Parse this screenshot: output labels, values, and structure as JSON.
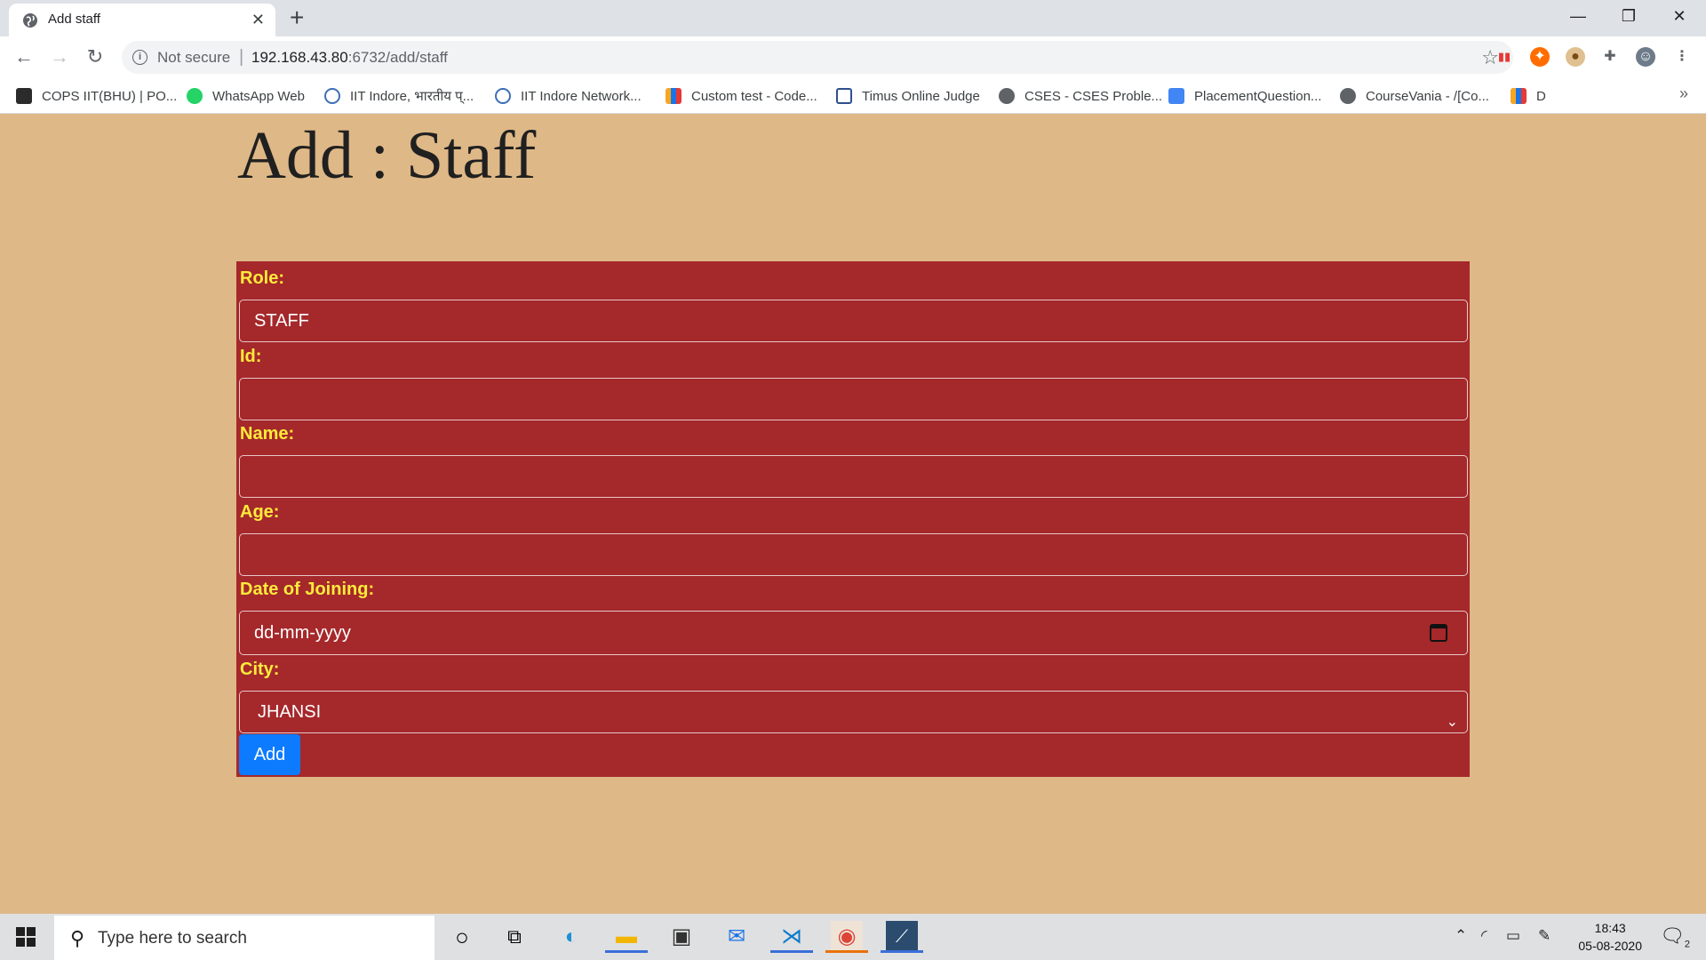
{
  "browser": {
    "tab_title": "Add staff",
    "tab_close": "✕",
    "new_tab": "+",
    "window_controls": {
      "minimize": "—",
      "restore": "❐",
      "close": "✕"
    },
    "security_label": "Not secure",
    "url_host": "192.168.43.80",
    "url_path": ":6732/add/staff",
    "bookmarks": [
      {
        "label": "COPS IIT(BHU) | PO...",
        "icon_color": "#2b2b2b"
      },
      {
        "label": "WhatsApp Web",
        "icon_color": "#25d366"
      },
      {
        "label": "IIT Indore, भारतीय प्...",
        "icon_color": "#3b6fb6"
      },
      {
        "label": "IIT Indore Network...",
        "icon_color": "#3b6fb6"
      },
      {
        "label": "Custom test - Code...",
        "icon_color": "#f5a623"
      },
      {
        "label": "Timus Online Judge",
        "icon_color": "#2f4f8f"
      },
      {
        "label": "CSES - CSES Proble...",
        "icon_color": "#5f6368"
      },
      {
        "label": "PlacementQuestion...",
        "icon_color": "#4285f4"
      },
      {
        "label": "CourseVania - /[Co...",
        "icon_color": "#5f6368"
      },
      {
        "label": "D",
        "icon_color": "#f5a623"
      }
    ],
    "bookmarks_overflow": "»"
  },
  "page": {
    "title": "Add : Staff",
    "form": {
      "role_label": "Role:",
      "role_value": "STAFF",
      "id_label": "Id:",
      "id_value": "",
      "name_label": "Name:",
      "name_value": "",
      "age_label": "Age:",
      "age_value": "",
      "doj_label": "Date of Joining:",
      "doj_placeholder": "dd-mm-yyyy",
      "city_label": "City:",
      "city_value": "JHANSI",
      "submit_label": "Add"
    },
    "colors": {
      "background": "#deb887",
      "form": "#a5282b",
      "label": "#ffeb3b",
      "button": "#0d7bff"
    }
  },
  "taskbar": {
    "search_placeholder": "Type here to search",
    "time": "18:43",
    "date": "05-08-2020",
    "notification_count": "2"
  }
}
